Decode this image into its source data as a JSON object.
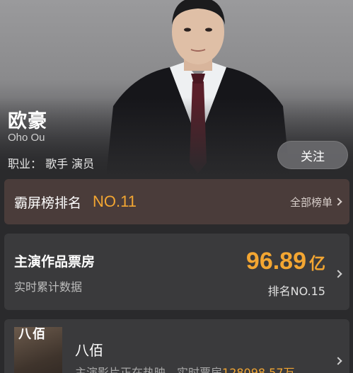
{
  "profile": {
    "name": "欧豪",
    "english_name": "Oho Ou",
    "occupation": "职业：  歌手 演员",
    "follow_label": "关注"
  },
  "rank": {
    "label": "霸屏榜排名",
    "value": "NO.11",
    "all_label": "全部榜单"
  },
  "box_office": {
    "title": "主演作品票房",
    "subtitle": "实时累计数据",
    "amount": "96.89",
    "unit": "亿",
    "rank_text": "排名NO.15"
  },
  "film": {
    "poster_text": "八佰",
    "title": "八佰",
    "desc_prefix": "主演影片正在热映，实时票房",
    "desc_value": "128098.57万"
  },
  "colors": {
    "accent": "#f3a632",
    "rank_card_bg": "#4a3c3a",
    "card_bg": "#3a3a3c",
    "page_bg": "#2a2a2c"
  },
  "icons": [
    "chevron-right-icon"
  ]
}
